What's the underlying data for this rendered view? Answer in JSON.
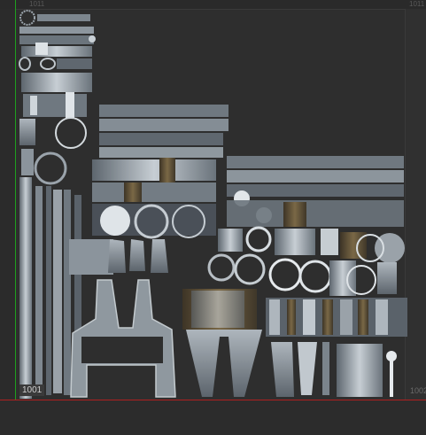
{
  "viewer": {
    "tile_label": "1001",
    "tile_top_label": "1011",
    "tile_right_top_label": "1011",
    "tile_right_label": "1002"
  },
  "colors": {
    "background": "#2b2b2b",
    "v_axis": "#1fa01f",
    "u_axis": "#b02020",
    "uv_light": "#c9d0d6",
    "uv_mid": "#8a949c",
    "uv_dark": "#4a5058",
    "uv_brown": "#6b5a3c"
  }
}
